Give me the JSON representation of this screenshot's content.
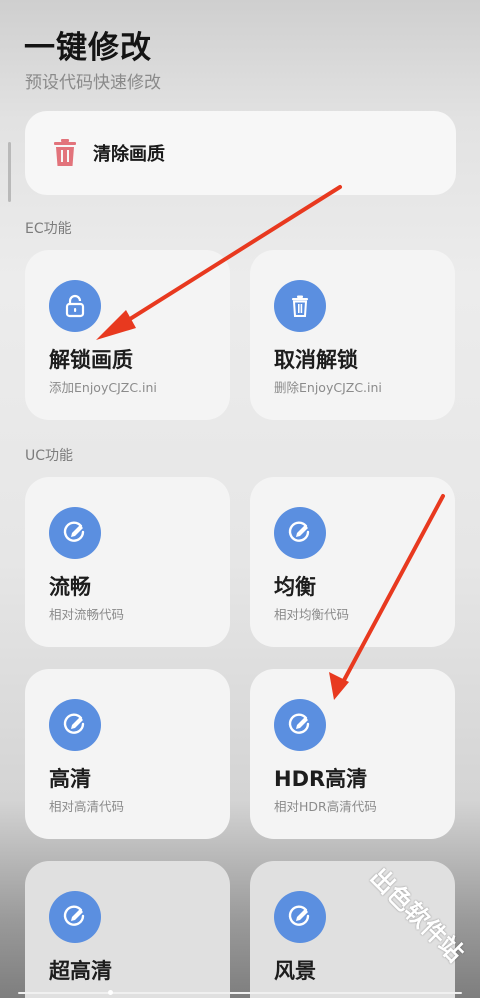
{
  "header": {
    "title": "一键修改",
    "subtitle": "预设代码快速修改"
  },
  "top_action": {
    "label": "清除画质",
    "icon": "trash-icon",
    "icon_color": "#e2737b"
  },
  "sections": [
    {
      "label": "EC功能",
      "cards": [
        {
          "title": "解锁画质",
          "desc": "添加EnjoyCJZC.ini",
          "icon": "lock-icon"
        },
        {
          "title": "取消解锁",
          "desc": "删除EnjoyCJZC.ini",
          "icon": "trash-icon"
        }
      ]
    },
    {
      "label": "UC功能",
      "cards": [
        {
          "title": "流畅",
          "desc": "相对流畅代码",
          "icon": "edit-icon"
        },
        {
          "title": "均衡",
          "desc": "相对均衡代码",
          "icon": "edit-icon"
        },
        {
          "title": "高清",
          "desc": "相对高清代码",
          "icon": "edit-icon"
        },
        {
          "title": "HDR高清",
          "desc": "相对HDR高清代码",
          "icon": "edit-icon"
        },
        {
          "title": "超高清",
          "desc": "",
          "icon": "edit-icon"
        },
        {
          "title": "风景",
          "desc": "",
          "icon": "edit-icon"
        }
      ]
    }
  ],
  "colors": {
    "accent": "#5b8fe0",
    "annotation_arrow": "#e8391f"
  },
  "watermark": "出色软件站"
}
